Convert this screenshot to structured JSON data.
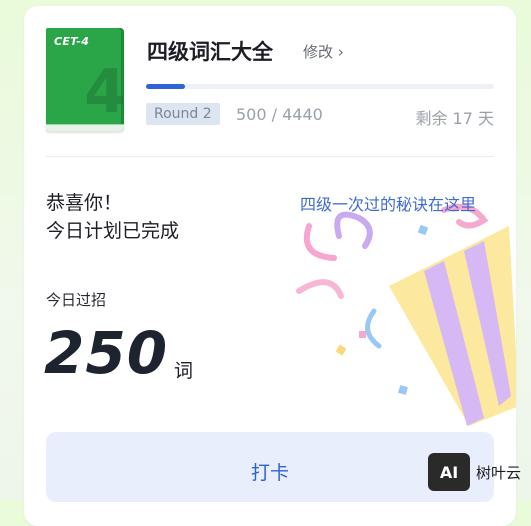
{
  "book": {
    "cover_title": "CET-4",
    "cover_numeral": "4",
    "name": "四级词汇大全",
    "edit_label": "修改 ›",
    "round_label": "Round 2",
    "progress_text": "500 / 4440",
    "progress_fraction": 0.1126,
    "remaining_text": "剩余 17 天",
    "accent_color": "#2f64d6",
    "cover_color": "#2aa548"
  },
  "plan": {
    "congrats_line1": "恭喜你！",
    "congrats_line2": "今日计划已完成",
    "tip_link": "四级一次过的秘诀在这里",
    "today_label": "今日过招",
    "today_count": "250",
    "unit": "词"
  },
  "actions": {
    "checkin_label": "打卡"
  },
  "watermark": {
    "logo_text": "AI",
    "brand": "树叶云"
  }
}
